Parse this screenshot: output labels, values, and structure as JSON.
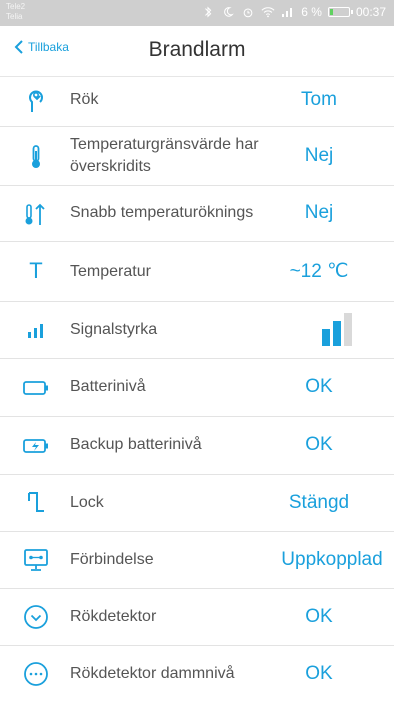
{
  "statusbar": {
    "carrier1": "Tele2",
    "carrier2": "Telia",
    "battery_percent": "6 %",
    "time": "00:37"
  },
  "header": {
    "back_label": "Tillbaka",
    "title": "Brandlarm"
  },
  "rows": [
    {
      "label": "Rök",
      "value": "Tom"
    },
    {
      "label": "Temperaturgränsvärde har överskridits",
      "value": "Nej"
    },
    {
      "label": "Snabb temperaturöknings",
      "value": "Nej"
    },
    {
      "label": "Temperatur",
      "value": "~12 ℃"
    },
    {
      "label": "Signalstyrka",
      "value": "",
      "signal_level": 2,
      "signal_max": 3
    },
    {
      "label": "Batterinivå",
      "value": "OK"
    },
    {
      "label": "Backup batterinivå",
      "value": "OK"
    },
    {
      "label": "Lock",
      "value": "Stängd"
    },
    {
      "label": "Förbindelse",
      "value": "Uppkopplad"
    },
    {
      "label": "Rökdetektor",
      "value": "OK"
    },
    {
      "label": "Rökdetektor dammnivå",
      "value": "OK"
    }
  ],
  "icons": {
    "temp_letter": "T"
  },
  "colors": {
    "accent": "#1aa0dc",
    "signal_inactive": "#d9d9d9",
    "statusbar_bg": "#cfcfcf"
  }
}
